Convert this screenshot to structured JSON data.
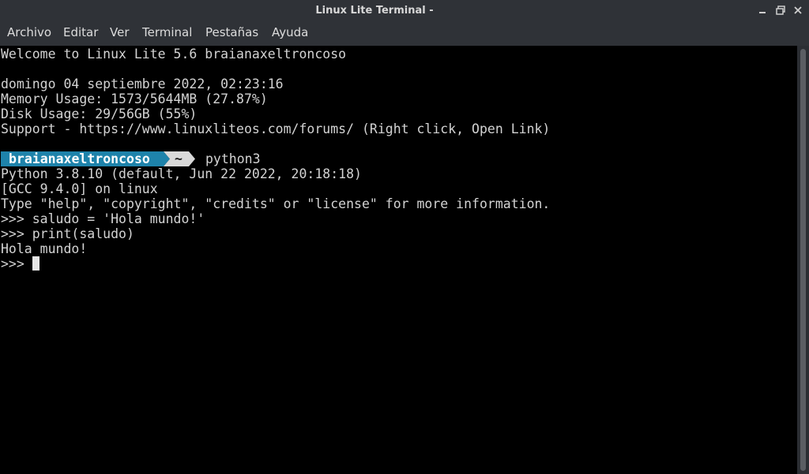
{
  "window": {
    "title": "Linux Lite Terminal -",
    "controls": [
      "minimize-icon",
      "maximize-icon",
      "close-icon"
    ]
  },
  "menu": [
    "Archivo",
    "Editar",
    "Ver",
    "Terminal",
    "Pestañas",
    "Ayuda"
  ],
  "terminal": {
    "welcome": "Welcome to Linux Lite 5.6 braianaxeltroncoso",
    "date": "domingo 04 septiembre 2022, 02:23:16",
    "memory": "Memory Usage: 1573/5644MB (27.87%)",
    "disk": "Disk Usage: 29/56GB (55%)",
    "support": "Support - https://www.linuxliteos.com/forums/ (Right click, Open Link)",
    "prompt_user": "braianaxeltroncoso",
    "prompt_dir": "~",
    "command": "python3",
    "python_version": "Python 3.8.10 (default, Jun 22 2022, 20:18:18)",
    "gcc": "[GCC 9.4.0] on linux",
    "type_help": "Type \"help\", \"copyright\", \"credits\" or \"license\" for more information.",
    "repl1": ">>> saludo = 'Hola mundo!'",
    "repl2": ">>> print(saludo)",
    "output": "Hola mundo!",
    "repl3": ">>> "
  },
  "colors": {
    "prompt_user_bg": "#1e83ab",
    "prompt_dir_bg": "#d9d9d9",
    "terminal_bg": "#000000",
    "terminal_fg": "#d3d3d3"
  }
}
